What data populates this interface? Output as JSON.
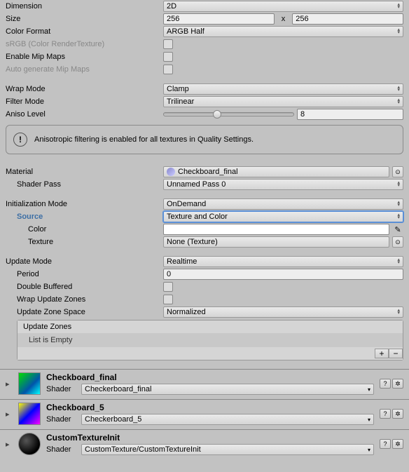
{
  "props": {
    "dimension": {
      "label": "Dimension",
      "value": "2D"
    },
    "size": {
      "label": "Size",
      "w": "256",
      "h": "256",
      "x": "x"
    },
    "colorFormat": {
      "label": "Color Format",
      "value": "ARGB Half"
    },
    "srgb": {
      "label": "sRGB (Color RenderTexture)"
    },
    "enableMip": {
      "label": "Enable Mip Maps"
    },
    "autoMip": {
      "label": "Auto generate Mip Maps"
    },
    "wrapMode": {
      "label": "Wrap Mode",
      "value": "Clamp"
    },
    "filterMode": {
      "label": "Filter Mode",
      "value": "Trilinear"
    },
    "anisoLevel": {
      "label": "Aniso Level",
      "value": "8",
      "pct": 38
    }
  },
  "info": {
    "text": "Anisotropic filtering is enabled for all textures in Quality Settings."
  },
  "material": {
    "label": "Material",
    "value": "Checkboard_final"
  },
  "shaderPass": {
    "label": "Shader Pass",
    "value": "Unnamed Pass 0"
  },
  "initMode": {
    "label": "Initialization Mode",
    "value": "OnDemand"
  },
  "source": {
    "label": "Source",
    "value": "Texture and Color"
  },
  "color": {
    "label": "Color"
  },
  "texture": {
    "label": "Texture",
    "value": "None (Texture)"
  },
  "updateMode": {
    "label": "Update Mode",
    "value": "Realtime"
  },
  "period": {
    "label": "Period",
    "value": "0"
  },
  "doubleBuffered": {
    "label": "Double Buffered"
  },
  "wrapUZ": {
    "label": "Wrap Update Zones"
  },
  "uzSpace": {
    "label": "Update Zone Space",
    "value": "Normalized"
  },
  "uz": {
    "header": "Update Zones",
    "empty": "List is Empty"
  },
  "materials": [
    {
      "name": "Checkboard_final",
      "shaderLabel": "Shader",
      "shader": "Checkerboard_final"
    },
    {
      "name": "Checkboard_5",
      "shaderLabel": "Shader",
      "shader": "Checkerboard_5"
    },
    {
      "name": "CustomTextureInit",
      "shaderLabel": "Shader",
      "shader": "CustomTexture/CustomTextureInit"
    }
  ],
  "glyphs": {
    "help": "?",
    "gear": "✲",
    "picker": "⊙",
    "eyedrop": "✎",
    "plus": "+",
    "minus": "−",
    "fold": "▸",
    "info": "!"
  }
}
